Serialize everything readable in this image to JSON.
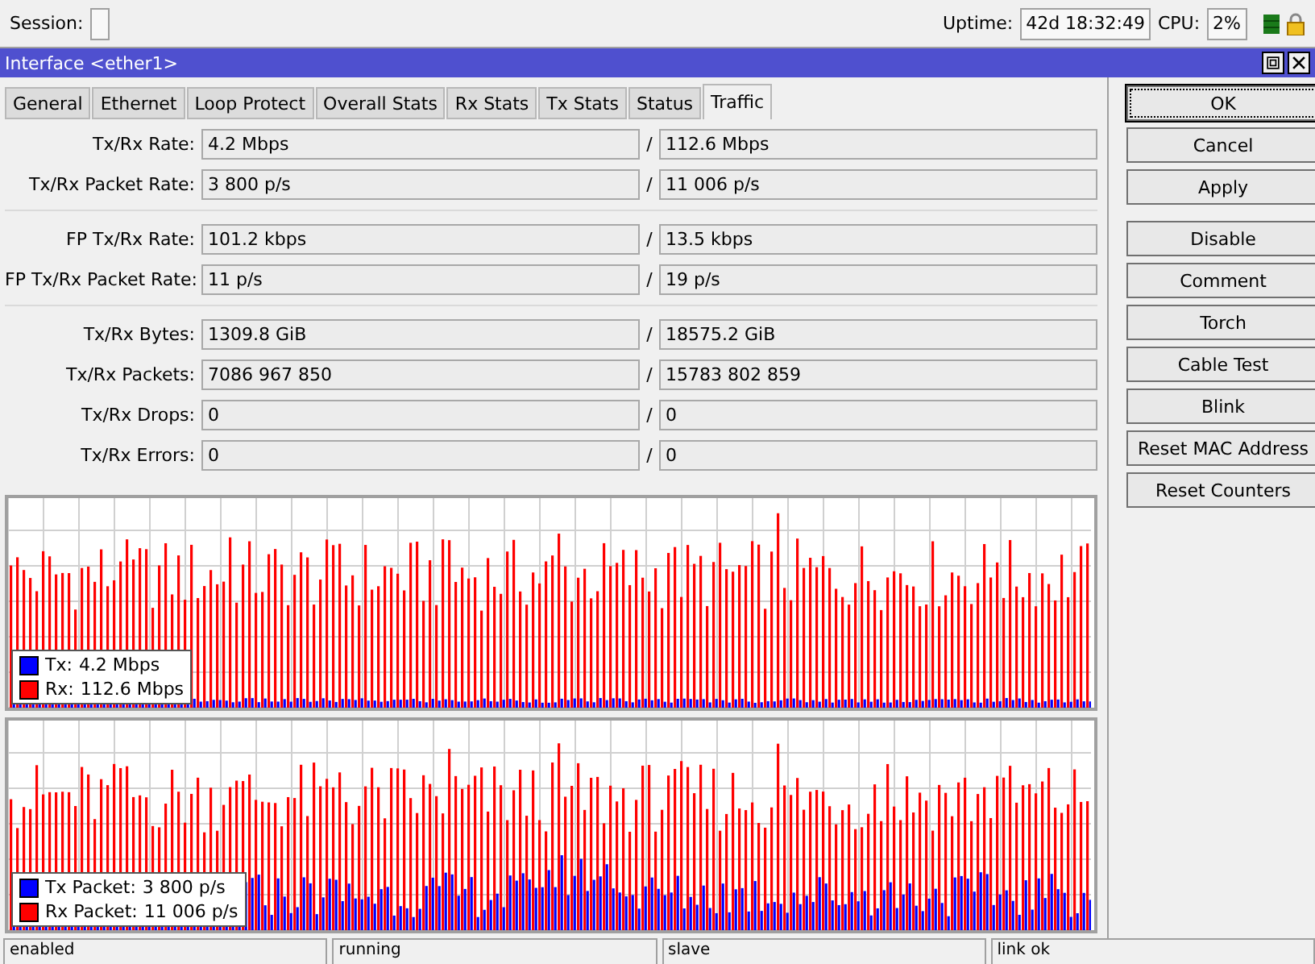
{
  "top_bar": {
    "session_label": "Session:",
    "uptime_label": "Uptime:",
    "uptime": "42d 18:32:49",
    "cpu_label": "CPU:",
    "cpu": "2%"
  },
  "window": {
    "title": "Interface <ether1>"
  },
  "tabs": [
    {
      "label": "General",
      "selected": false
    },
    {
      "label": "Ethernet",
      "selected": false
    },
    {
      "label": "Loop Protect",
      "selected": false
    },
    {
      "label": "Overall Stats",
      "selected": false
    },
    {
      "label": "Rx Stats",
      "selected": false
    },
    {
      "label": "Tx Stats",
      "selected": false
    },
    {
      "label": "Status",
      "selected": false
    },
    {
      "label": "Traffic",
      "selected": true
    }
  ],
  "field_groups": [
    [
      {
        "label": "Tx/Rx Rate:",
        "tx": "4.2 Mbps",
        "rx": "112.6 Mbps"
      },
      {
        "label": "Tx/Rx Packet Rate:",
        "tx": "3 800 p/s",
        "rx": "11 006 p/s"
      }
    ],
    [
      {
        "label": "FP Tx/Rx Rate:",
        "tx": "101.2 kbps",
        "rx": "13.5 kbps"
      },
      {
        "label": "FP Tx/Rx Packet Rate:",
        "tx": "11 p/s",
        "rx": "19 p/s"
      }
    ],
    [
      {
        "label": "Tx/Rx Bytes:",
        "tx": "1309.8 GiB",
        "rx": "18575.2 GiB"
      },
      {
        "label": "Tx/Rx Packets:",
        "tx": "7086 967 850",
        "rx": "15783 802 859"
      },
      {
        "label": "Tx/Rx Drops:",
        "tx": "0",
        "rx": "0"
      },
      {
        "label": "Tx/Rx Errors:",
        "tx": "0",
        "rx": "0"
      }
    ]
  ],
  "separator": "/",
  "graphs": [
    {
      "legend": [
        {
          "label": "Tx:",
          "value": "4.2 Mbps",
          "color": "#0000ff"
        },
        {
          "label": "Rx:",
          "value": "112.6 Mbps",
          "color": "#ff0000"
        }
      ]
    },
    {
      "legend": [
        {
          "label": "Tx Packet:",
          "value": "3 800 p/s",
          "color": "#0000ff"
        },
        {
          "label": "Rx Packet:",
          "value": "11 006 p/s",
          "color": "#ff0000"
        }
      ]
    }
  ],
  "buttons": [
    [
      {
        "label": "OK",
        "selected": true
      },
      {
        "label": "Cancel",
        "selected": false
      },
      {
        "label": "Apply",
        "selected": false
      }
    ],
    [
      {
        "label": "Disable",
        "selected": false
      },
      {
        "label": "Comment",
        "selected": false
      },
      {
        "label": "Torch",
        "selected": false
      },
      {
        "label": "Cable Test",
        "selected": false
      },
      {
        "label": "Blink",
        "selected": false
      },
      {
        "label": "Reset MAC Address",
        "selected": false
      },
      {
        "label": "Reset Counters",
        "selected": false
      }
    ]
  ],
  "status_bar": [
    "enabled",
    "running",
    "slave",
    "link ok"
  ]
}
